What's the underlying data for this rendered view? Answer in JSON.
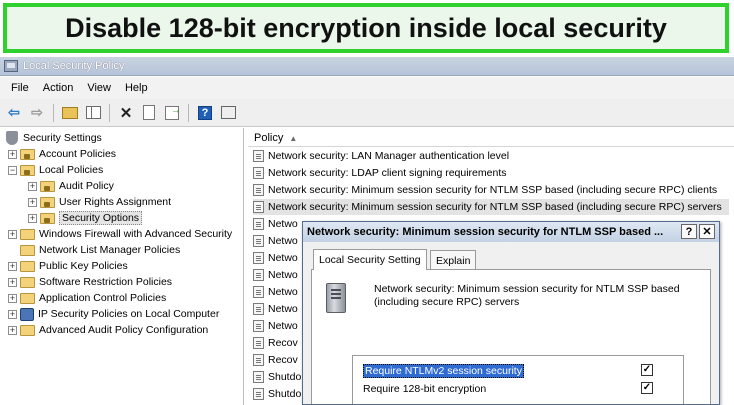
{
  "banner": {
    "title": "Disable 128-bit encryption inside local security"
  },
  "window": {
    "title": "Local Security Policy"
  },
  "menu": [
    "File",
    "Action",
    "View",
    "Help"
  ],
  "tree": {
    "root": "Security Settings",
    "items": [
      {
        "label": "Account Policies"
      },
      {
        "label": "Local Policies"
      },
      {
        "label": "Audit Policy"
      },
      {
        "label": "User Rights Assignment"
      },
      {
        "label": "Security Options"
      },
      {
        "label": "Windows Firewall with Advanced Security"
      },
      {
        "label": "Network List Manager Policies"
      },
      {
        "label": "Public Key Policies"
      },
      {
        "label": "Software Restriction Policies"
      },
      {
        "label": "Application Control Policies"
      },
      {
        "label": "IP Security Policies on Local Computer"
      },
      {
        "label": "Advanced Audit Policy Configuration"
      }
    ]
  },
  "list": {
    "column_header": "Policy",
    "rows": [
      "Network security: LAN Manager authentication level",
      "Network security: LDAP client signing requirements",
      "Network security: Minimum session security for NTLM SSP based (including secure RPC) clients",
      "Network security: Minimum session security for NTLM SSP based (including secure RPC) servers",
      "Netwo",
      "Netwo",
      "Netwo",
      "Netwo",
      "Netwo",
      "Netwo",
      "Netwo",
      "Recov",
      "Recov",
      "Shutdo",
      "Shutdo"
    ]
  },
  "dialog": {
    "title": "Network security: Minimum session security for NTLM SSP based ...",
    "help_label": "?",
    "close_label": "✕",
    "tabs": [
      "Local Security Setting",
      "Explain"
    ],
    "description": "Network security: Minimum session security for NTLM SSP based (including secure RPC) servers",
    "options": [
      {
        "label": "Require NTLMv2 session security",
        "checked": "✓"
      },
      {
        "label": "Require 128-bit encryption",
        "checked": "✓"
      }
    ]
  },
  "colors": {
    "banner_border": "#2fd12f",
    "selection": "#2f6bd1"
  }
}
